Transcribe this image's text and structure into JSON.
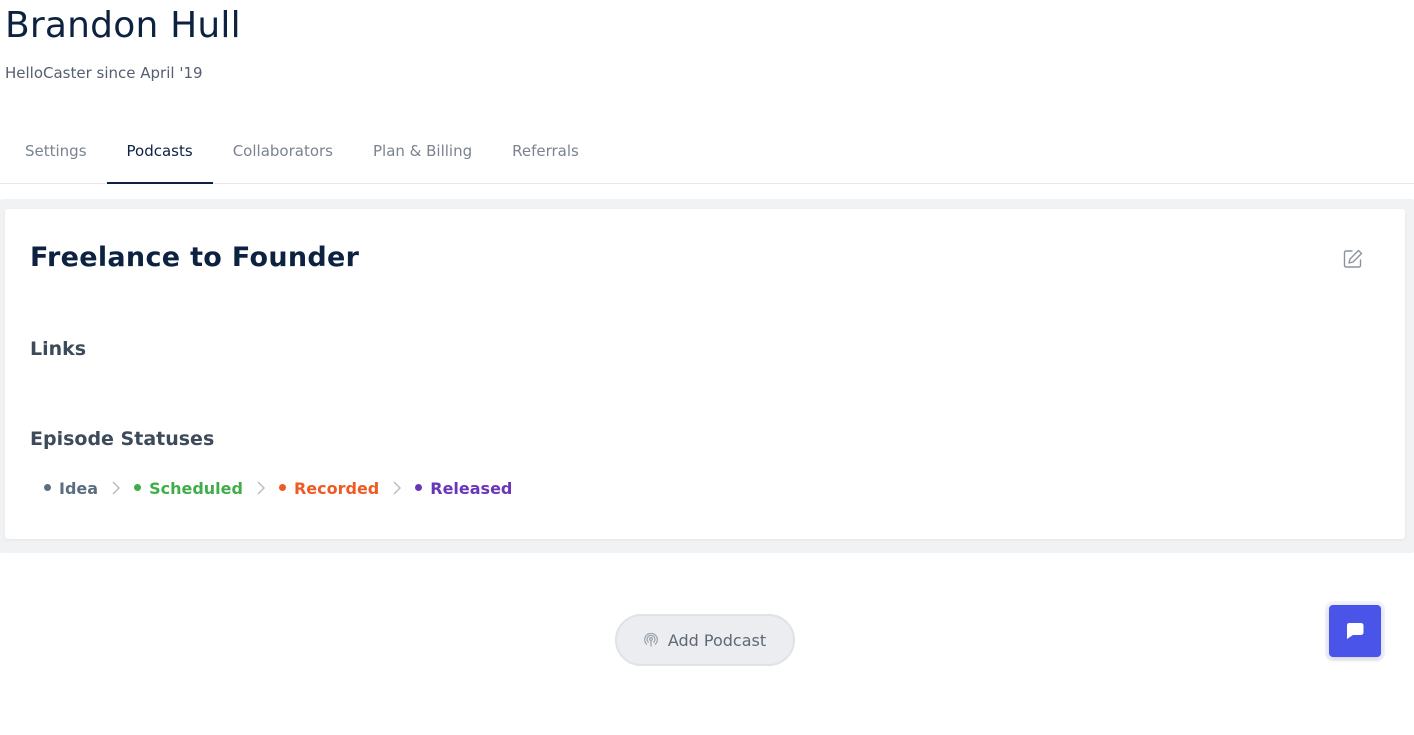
{
  "user": {
    "name": "Brandon Hull",
    "since": "HelloCaster since April '19"
  },
  "tabs": [
    {
      "label": "Settings",
      "active": false
    },
    {
      "label": "Podcasts",
      "active": true
    },
    {
      "label": "Collaborators",
      "active": false
    },
    {
      "label": "Plan & Billing",
      "active": false
    },
    {
      "label": "Referrals",
      "active": false
    }
  ],
  "podcast": {
    "title": "Freelance to Founder",
    "edit_icon": "edit-icon",
    "links_title": "Links",
    "statuses_title": "Episode Statuses",
    "statuses": [
      {
        "label": "Idea",
        "color": "#5c6f80"
      },
      {
        "label": "Scheduled",
        "color": "#3fae49"
      },
      {
        "label": "Recorded",
        "color": "#f05a22"
      },
      {
        "label": "Released",
        "color": "#6a36b8"
      }
    ]
  },
  "add_podcast": {
    "label": "Add Podcast",
    "icon": "podcast-icon"
  },
  "chat": {
    "icon": "chat-icon",
    "color": "#4b54e8"
  }
}
